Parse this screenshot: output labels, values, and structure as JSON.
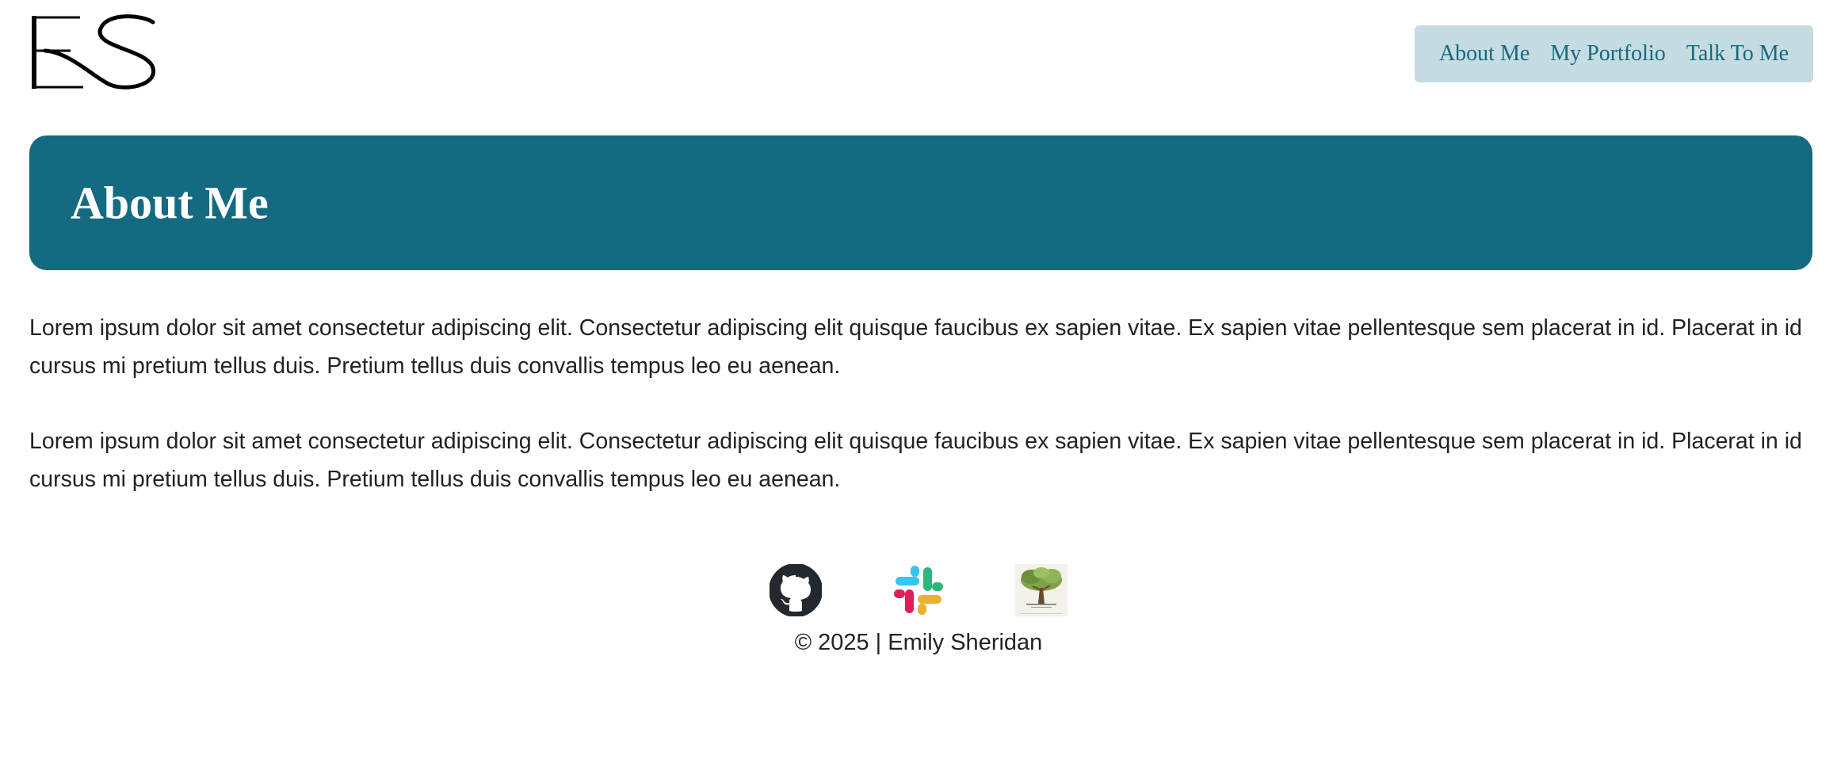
{
  "header": {
    "logo": {
      "alt": "ES"
    },
    "nav": [
      {
        "label": "About Me"
      },
      {
        "label": "My Portfolio"
      },
      {
        "label": "Talk To Me"
      }
    ]
  },
  "banner": {
    "title": "About Me"
  },
  "content": {
    "paragraphs": [
      "Lorem ipsum dolor sit amet consectetur adipiscing elit. Consectetur adipiscing elit quisque faucibus ex sapien vitae. Ex sapien vitae pellentesque sem placerat in id. Placerat in id cursus mi pretium tellus duis. Pretium tellus duis convallis tempus leo eu aenean.",
      "Lorem ipsum dolor sit amet consectetur adipiscing elit. Consectetur adipiscing elit quisque faucibus ex sapien vitae. Ex sapien vitae pellentesque sem placerat in id. Placerat in id cursus mi pretium tellus duis. Pretium tellus duis convallis tempus leo eu aenean."
    ]
  },
  "footer": {
    "social_links": [
      {
        "icon": "github-icon"
      },
      {
        "icon": "slack-icon"
      },
      {
        "icon": "tree-logo-icon"
      }
    ],
    "copyright": "© 2025 | Emily Sheridan"
  },
  "colors": {
    "accent": "#146a80",
    "nav_background": "#c4dce2",
    "nav_text": "#16697e",
    "text": "#222222",
    "background": "#ffffff"
  }
}
